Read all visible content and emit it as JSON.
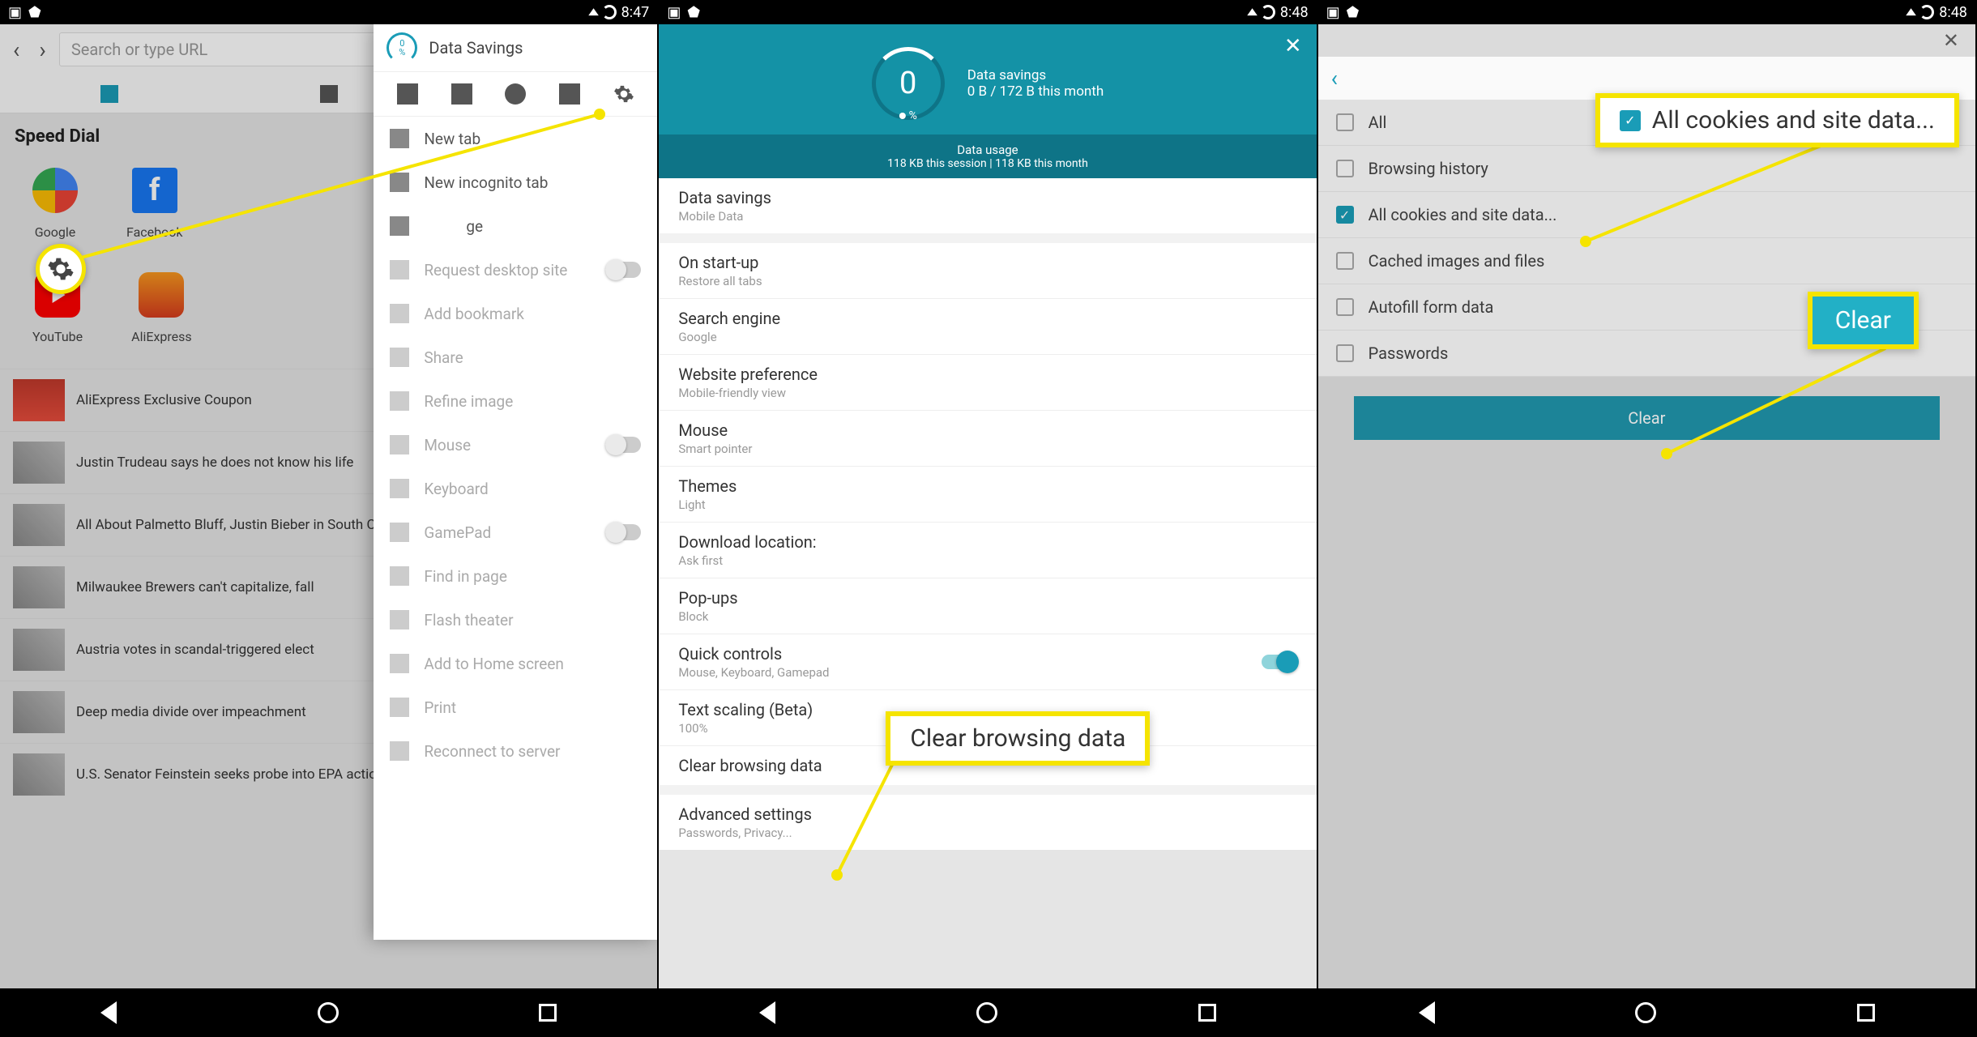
{
  "status": {
    "time1": "8:47",
    "time2": "8:48",
    "time3": "8:48"
  },
  "panel1": {
    "url_placeholder": "Search or type URL",
    "speed_dial": "Speed Dial",
    "sd": [
      {
        "label": "Google"
      },
      {
        "label": "Facebook"
      },
      {
        "label": "YouTube"
      },
      {
        "label": "AliExpress"
      }
    ],
    "news": [
      "AliExpress Exclusive Coupon",
      "Justin Trudeau says he does not know his life",
      "All About Palmetto Bluff, Justin Bieber in South Carolina",
      "Milwaukee Brewers can't capitalize, fall",
      "Austria votes in scandal-triggered elect",
      "Deep media divide over impeachment",
      "U.S. Senator Feinstein seeks probe into EPA actions against California"
    ],
    "menu": {
      "title": "Data Savings",
      "items": [
        "New tab",
        "New incognito tab",
        "ge",
        "Request desktop site",
        "Add bookmark",
        "Share",
        "Refine image",
        "Mouse",
        "Keyboard",
        "GamePad",
        "Find in page",
        "Flash theater",
        "Add to Home screen",
        "Print",
        "Reconnect to server"
      ]
    }
  },
  "panel2": {
    "savings_label": "Data savings",
    "savings_value": "0 B / 172 B this month",
    "usage_label": "Data usage",
    "usage_value": "118 KB this session  |  118 KB this month",
    "gauge_val": "0",
    "gauge_pct": "%",
    "settings": [
      {
        "t": "Data savings",
        "s": "Mobile Data"
      },
      {
        "t": "On start-up",
        "s": "Restore all tabs"
      },
      {
        "t": "Search engine",
        "s": "Google"
      },
      {
        "t": "Website preference",
        "s": "Mobile-friendly view"
      },
      {
        "t": "Mouse",
        "s": "Smart pointer"
      },
      {
        "t": "Themes",
        "s": "Light"
      },
      {
        "t": "Download location:",
        "s": "Ask first"
      },
      {
        "t": "Pop-ups",
        "s": "Block"
      },
      {
        "t": "Quick controls",
        "s": "Mouse, Keyboard, Gamepad",
        "on": true
      },
      {
        "t": "Text scaling (Beta)",
        "s": "100%"
      },
      {
        "t": "Clear browsing data",
        "s": ""
      },
      {
        "t": "Advanced settings",
        "s": "Passwords, Privacy..."
      }
    ],
    "callout": "Clear browsing data"
  },
  "panel3": {
    "options": [
      {
        "label": "All",
        "checked": false
      },
      {
        "label": "Browsing history",
        "checked": false
      },
      {
        "label": "All cookies and site data...",
        "checked": true
      },
      {
        "label": "Cached images and files",
        "checked": false
      },
      {
        "label": "Autofill form data",
        "checked": false
      },
      {
        "label": "Passwords",
        "checked": false
      }
    ],
    "clear": "Clear",
    "callout1": "All cookies and site data...",
    "callout2": "Clear"
  }
}
